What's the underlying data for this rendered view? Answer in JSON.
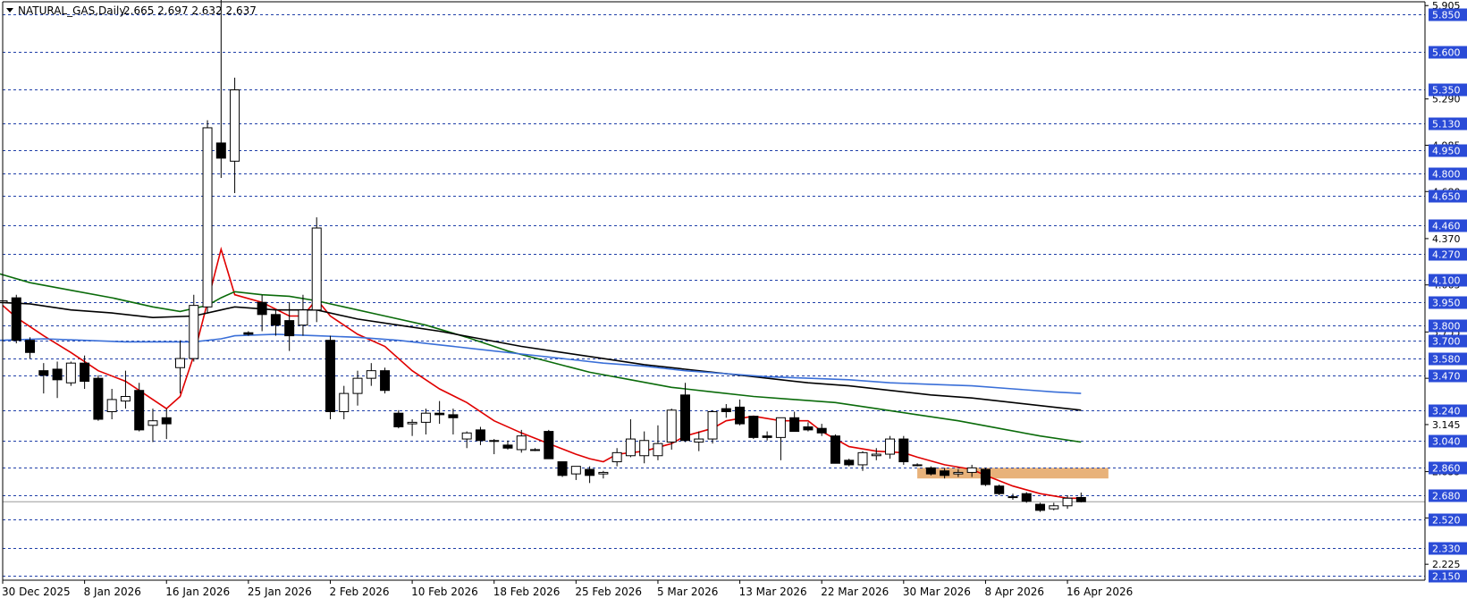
{
  "header": {
    "collapse_arrow": "triangle-down-icon",
    "symbol_label": "NATURAL_GAS,Daily",
    "ohlc_label": "2.665 2.697 2.632 2.637"
  },
  "colors": {
    "background": "#ffffff",
    "frame": "#000000",
    "level_line": "#1f3fa8",
    "level_label_bg": "#2a4bd7",
    "level_label_text": "#ffffff",
    "bull_fill": "#ffffff",
    "bear_fill": "#000000",
    "candle_outline": "#000000",
    "ma_red": "#e00000",
    "ma_green": "#0a6b0a",
    "ma_black": "#000000",
    "ma_blue": "#3a6fd8",
    "zone_fill": "#e8b27a",
    "current_price_line": "#9a9a9a"
  },
  "chart_data": {
    "type": "candlestick",
    "title": "NATURAL_GAS,Daily",
    "ylim": [
      2.12,
      5.93
    ],
    "price_axis_ticks": [
      "5.905",
      "5.290",
      "4.985",
      "4.680",
      "4.370",
      "4.065",
      "3.755",
      "3.450",
      "3.145",
      "2.835",
      "2.530",
      "2.225"
    ],
    "x_labels": [
      {
        "label": "30 Dec 2025",
        "index": 0
      },
      {
        "label": "8 Jan 2026",
        "index": 6
      },
      {
        "label": "16 Jan 2026",
        "index": 12
      },
      {
        "label": "25 Jan 2026",
        "index": 18
      },
      {
        "label": "2 Feb 2026",
        "index": 24
      },
      {
        "label": "10 Feb 2026",
        "index": 30
      },
      {
        "label": "18 Feb 2026",
        "index": 36
      },
      {
        "label": "25 Feb 2026",
        "index": 42
      },
      {
        "label": "5 Mar 2026",
        "index": 48
      },
      {
        "label": "13 Mar 2026",
        "index": 54
      },
      {
        "label": "22 Mar 2026",
        "index": 60
      },
      {
        "label": "30 Mar 2026",
        "index": 66
      },
      {
        "label": "8 Apr 2026",
        "index": 72
      },
      {
        "label": "16 Apr 2026",
        "index": 78
      }
    ],
    "levels": [
      "5.850",
      "5.600",
      "5.350",
      "5.130",
      "4.950",
      "4.800",
      "4.650",
      "4.460",
      "4.270",
      "4.100",
      "3.950",
      "3.800",
      "3.700",
      "3.580",
      "3.470",
      "3.240",
      "3.040",
      "2.860",
      "2.680",
      "2.520",
      "2.330",
      "2.150"
    ],
    "current_price": "2.637",
    "zone": {
      "start_index": 67,
      "end_index": 81,
      "low": 2.79,
      "high": 2.86
    },
    "candles": [
      [
        3.95,
        4.02,
        3.86,
        3.96
      ],
      [
        3.98,
        4.0,
        3.68,
        3.7
      ],
      [
        3.7,
        3.72,
        3.58,
        3.62
      ],
      [
        3.5,
        3.55,
        3.35,
        3.47
      ],
      [
        3.51,
        3.56,
        3.32,
        3.44
      ],
      [
        3.42,
        3.56,
        3.4,
        3.55
      ],
      [
        3.55,
        3.6,
        3.38,
        3.43
      ],
      [
        3.45,
        3.47,
        3.17,
        3.18
      ],
      [
        3.23,
        3.38,
        3.18,
        3.31
      ],
      [
        3.3,
        3.5,
        3.25,
        3.33
      ],
      [
        3.37,
        3.42,
        3.1,
        3.11
      ],
      [
        3.14,
        3.25,
        3.03,
        3.17
      ],
      [
        3.19,
        3.25,
        3.05,
        3.15
      ],
      [
        3.52,
        3.7,
        3.35,
        3.58
      ],
      [
        3.58,
        4.0,
        3.56,
        3.93
      ],
      [
        3.92,
        5.15,
        3.88,
        5.1
      ],
      [
        5.0,
        6.0,
        4.77,
        4.9
      ],
      [
        4.88,
        5.43,
        4.67,
        5.35
      ],
      [
        3.75,
        3.76,
        3.73,
        3.74
      ],
      [
        3.95,
        4.0,
        3.76,
        3.87
      ],
      [
        3.87,
        3.9,
        3.73,
        3.8
      ],
      [
        3.83,
        3.95,
        3.63,
        3.73
      ],
      [
        3.8,
        4.0,
        3.73,
        3.9
      ],
      [
        3.9,
        4.51,
        3.82,
        4.44
      ],
      [
        3.7,
        3.73,
        3.18,
        3.23
      ],
      [
        3.23,
        3.4,
        3.18,
        3.35
      ],
      [
        3.35,
        3.5,
        3.27,
        3.45
      ],
      [
        3.45,
        3.55,
        3.4,
        3.5
      ],
      [
        3.5,
        3.52,
        3.35,
        3.37
      ],
      [
        3.22,
        3.24,
        3.12,
        3.13
      ],
      [
        3.15,
        3.18,
        3.07,
        3.16
      ],
      [
        3.16,
        3.25,
        3.08,
        3.22
      ],
      [
        3.22,
        3.3,
        3.15,
        3.21
      ],
      [
        3.21,
        3.25,
        3.08,
        3.19
      ],
      [
        3.05,
        3.1,
        2.99,
        3.09
      ],
      [
        3.11,
        3.13,
        3.01,
        3.04
      ],
      [
        3.04,
        3.05,
        2.95,
        3.04
      ],
      [
        3.01,
        3.04,
        2.98,
        2.99
      ],
      [
        2.98,
        3.11,
        2.96,
        3.07
      ],
      [
        2.98,
        2.99,
        2.97,
        2.98
      ],
      [
        3.1,
        3.11,
        2.92,
        2.92
      ],
      [
        2.9,
        2.9,
        2.8,
        2.81
      ],
      [
        2.82,
        2.87,
        2.78,
        2.87
      ],
      [
        2.85,
        2.87,
        2.76,
        2.81
      ],
      [
        2.82,
        2.84,
        2.79,
        2.83
      ],
      [
        2.9,
        2.99,
        2.87,
        2.96
      ],
      [
        2.94,
        3.18,
        2.93,
        3.05
      ],
      [
        2.94,
        3.1,
        2.89,
        3.04
      ],
      [
        2.94,
        3.14,
        2.91,
        3.02
      ],
      [
        3.03,
        3.25,
        2.98,
        3.24
      ],
      [
        3.34,
        3.42,
        3.03,
        3.04
      ],
      [
        3.03,
        3.1,
        2.97,
        3.05
      ],
      [
        3.05,
        3.24,
        3.02,
        3.23
      ],
      [
        3.25,
        3.28,
        3.19,
        3.23
      ],
      [
        3.26,
        3.31,
        3.14,
        3.15
      ],
      [
        3.2,
        3.2,
        3.05,
        3.06
      ],
      [
        3.07,
        3.1,
        3.04,
        3.06
      ],
      [
        3.06,
        3.19,
        2.91,
        3.19
      ],
      [
        3.19,
        3.23,
        3.1,
        3.1
      ],
      [
        3.13,
        3.16,
        3.1,
        3.11
      ],
      [
        3.12,
        3.15,
        3.07,
        3.09
      ],
      [
        3.07,
        3.08,
        2.89,
        2.89
      ],
      [
        2.91,
        2.92,
        2.87,
        2.88
      ],
      [
        2.88,
        2.97,
        2.84,
        2.96
      ],
      [
        2.94,
        2.99,
        2.91,
        2.95
      ],
      [
        2.95,
        3.07,
        2.92,
        3.05
      ],
      [
        3.05,
        3.07,
        2.88,
        2.9
      ],
      [
        2.88,
        2.89,
        2.87,
        2.88
      ],
      [
        2.86,
        2.87,
        2.81,
        2.82
      ],
      [
        2.84,
        2.86,
        2.79,
        2.81
      ],
      [
        2.82,
        2.85,
        2.8,
        2.83
      ],
      [
        2.83,
        2.88,
        2.8,
        2.86
      ],
      [
        2.85,
        2.86,
        2.74,
        2.75
      ],
      [
        2.74,
        2.75,
        2.68,
        2.69
      ],
      [
        2.67,
        2.69,
        2.65,
        2.67
      ],
      [
        2.69,
        2.7,
        2.63,
        2.64
      ],
      [
        2.62,
        2.63,
        2.57,
        2.58
      ],
      [
        2.59,
        2.63,
        2.58,
        2.61
      ],
      [
        2.61,
        2.68,
        2.59,
        2.66
      ],
      [
        2.665,
        2.697,
        2.632,
        2.637
      ]
    ],
    "series": [
      {
        "name": "",
        "color": "#e00000",
        "points": [
          [
            0,
            3.93
          ],
          [
            1,
            3.85
          ],
          [
            3,
            3.73
          ],
          [
            5,
            3.62
          ],
          [
            7,
            3.5
          ],
          [
            9,
            3.43
          ],
          [
            11,
            3.31
          ],
          [
            12,
            3.25
          ],
          [
            13,
            3.33
          ],
          [
            14,
            3.6
          ],
          [
            16,
            4.3
          ],
          [
            17,
            4.0
          ],
          [
            19,
            3.95
          ],
          [
            21,
            3.86
          ],
          [
            22,
            3.86
          ],
          [
            23,
            3.97
          ],
          [
            24,
            3.86
          ],
          [
            26,
            3.74
          ],
          [
            28,
            3.66
          ],
          [
            30,
            3.5
          ],
          [
            32,
            3.38
          ],
          [
            34,
            3.29
          ],
          [
            36,
            3.17
          ],
          [
            38,
            3.09
          ],
          [
            40,
            3.02
          ],
          [
            42,
            2.95
          ],
          [
            43,
            2.92
          ],
          [
            44,
            2.9
          ],
          [
            45,
            2.95
          ],
          [
            47,
            2.97
          ],
          [
            49,
            3.02
          ],
          [
            50,
            3.07
          ],
          [
            52,
            3.12
          ],
          [
            53,
            3.17
          ],
          [
            55,
            3.2
          ],
          [
            57,
            3.17
          ],
          [
            59,
            3.17
          ],
          [
            60,
            3.1
          ],
          [
            62,
            3.0
          ],
          [
            64,
            2.97
          ],
          [
            66,
            2.96
          ],
          [
            67,
            2.93
          ],
          [
            69,
            2.88
          ],
          [
            71,
            2.85
          ],
          [
            72,
            2.81
          ],
          [
            74,
            2.74
          ],
          [
            76,
            2.69
          ],
          [
            78,
            2.66
          ],
          [
            79,
            2.66
          ]
        ]
      },
      {
        "name": "",
        "color": "#0a6b0a",
        "points": [
          [
            -0.3,
            4.14
          ],
          [
            2,
            4.08
          ],
          [
            5,
            4.03
          ],
          [
            8,
            3.98
          ],
          [
            11,
            3.92
          ],
          [
            13,
            3.89
          ],
          [
            15,
            3.93
          ],
          [
            16,
            3.98
          ],
          [
            17,
            4.02
          ],
          [
            19,
            4.0
          ],
          [
            21,
            3.99
          ],
          [
            23,
            3.96
          ],
          [
            25,
            3.92
          ],
          [
            28,
            3.86
          ],
          [
            31,
            3.8
          ],
          [
            34,
            3.72
          ],
          [
            37,
            3.63
          ],
          [
            40,
            3.56
          ],
          [
            43,
            3.49
          ],
          [
            46,
            3.44
          ],
          [
            49,
            3.39
          ],
          [
            52,
            3.36
          ],
          [
            55,
            3.33
          ],
          [
            58,
            3.31
          ],
          [
            61,
            3.29
          ],
          [
            64,
            3.25
          ],
          [
            67,
            3.21
          ],
          [
            70,
            3.17
          ],
          [
            73,
            3.12
          ],
          [
            76,
            3.07
          ],
          [
            79,
            3.03
          ]
        ]
      },
      {
        "name": "",
        "color": "#000000",
        "points": [
          [
            -0.3,
            3.95
          ],
          [
            2,
            3.94
          ],
          [
            5,
            3.9
          ],
          [
            8,
            3.88
          ],
          [
            11,
            3.85
          ],
          [
            14,
            3.86
          ],
          [
            16,
            3.9
          ],
          [
            17,
            3.92
          ],
          [
            20,
            3.9
          ],
          [
            23,
            3.9
          ],
          [
            26,
            3.84
          ],
          [
            29,
            3.8
          ],
          [
            32,
            3.76
          ],
          [
            35,
            3.71
          ],
          [
            38,
            3.66
          ],
          [
            41,
            3.62
          ],
          [
            44,
            3.58
          ],
          [
            47,
            3.54
          ],
          [
            50,
            3.51
          ],
          [
            53,
            3.48
          ],
          [
            56,
            3.45
          ],
          [
            59,
            3.42
          ],
          [
            62,
            3.4
          ],
          [
            65,
            3.37
          ],
          [
            68,
            3.34
          ],
          [
            71,
            3.32
          ],
          [
            74,
            3.29
          ],
          [
            77,
            3.26
          ],
          [
            79,
            3.24
          ]
        ]
      },
      {
        "name": "",
        "color": "#3a6fd8",
        "points": [
          [
            -0.3,
            3.7
          ],
          [
            3,
            3.71
          ],
          [
            6,
            3.7
          ],
          [
            9,
            3.69
          ],
          [
            12,
            3.69
          ],
          [
            14,
            3.69
          ],
          [
            16,
            3.71
          ],
          [
            17,
            3.73
          ],
          [
            20,
            3.74
          ],
          [
            23,
            3.73
          ],
          [
            26,
            3.72
          ],
          [
            29,
            3.7
          ],
          [
            32,
            3.67
          ],
          [
            35,
            3.64
          ],
          [
            38,
            3.61
          ],
          [
            41,
            3.58
          ],
          [
            44,
            3.55
          ],
          [
            47,
            3.53
          ],
          [
            50,
            3.5
          ],
          [
            53,
            3.48
          ],
          [
            56,
            3.46
          ],
          [
            59,
            3.45
          ],
          [
            62,
            3.44
          ],
          [
            65,
            3.42
          ],
          [
            68,
            3.41
          ],
          [
            71,
            3.4
          ],
          [
            74,
            3.38
          ],
          [
            77,
            3.36
          ],
          [
            79,
            3.35
          ]
        ]
      }
    ]
  }
}
